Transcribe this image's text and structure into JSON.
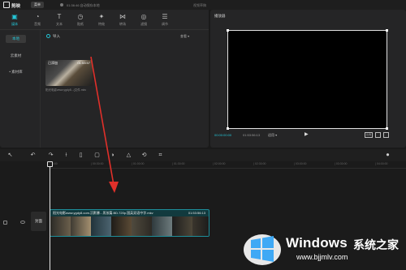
{
  "titlebar": {
    "app_name": "剪映",
    "menu_label": "菜单",
    "autosave": "01:36:46 自动保存本地",
    "project_title": "视频草稿"
  },
  "tabs": [
    {
      "label": "媒体",
      "icon": "media-icon",
      "active": true
    },
    {
      "label": "音频",
      "icon": "audio-icon",
      "active": false
    },
    {
      "label": "文本",
      "icon": "text-icon",
      "active": false
    },
    {
      "label": "贴纸",
      "icon": "sticker-icon",
      "active": false
    },
    {
      "label": "特效",
      "icon": "effects-icon",
      "active": false
    },
    {
      "label": "转场",
      "icon": "transition-icon",
      "active": false
    },
    {
      "label": "滤镜",
      "icon": "filter-icon",
      "active": false
    },
    {
      "label": "调节",
      "icon": "adjust-icon",
      "active": false
    }
  ],
  "sidenav": [
    {
      "label": "本地",
      "active": true
    },
    {
      "label": "云素材",
      "active": false
    },
    {
      "label": "• 素材库",
      "active": false
    }
  ],
  "media": {
    "import_label": "导入",
    "view_label": "查看 ▾",
    "clip_added": "已添加",
    "clip_duration": "01:53:57",
    "clip_filename": "阳光电影www.ygdy8...(文件.mkv"
  },
  "player": {
    "title": "播放器",
    "time_current": "00:00:00:00",
    "time_total": "01:53:56:13",
    "quality": "适用 ▾",
    "ratio_label": "比例"
  },
  "timeline": {
    "ticks": [
      "00:00",
      "| 00:30:00",
      "| 01:00:00",
      "| 01:30:00",
      "| 02:00:00",
      "| 02:30:00",
      "| 03:00:00",
      "| 03:30:00",
      "| 04:00:00"
    ],
    "cover_label": "封面",
    "clip_label": "阳光电影www.ygdy8.com.沉默暴...男孩篇.BD.720p.国英双语中字.mkv",
    "clip_duration": "01:53:56:13"
  },
  "watermark": {
    "brand": "Windows",
    "brand_cn": "系统之家",
    "url": "www.bjjmlv.com"
  },
  "colors": {
    "accent": "#24c5d6",
    "arrow": "#e0302a"
  }
}
